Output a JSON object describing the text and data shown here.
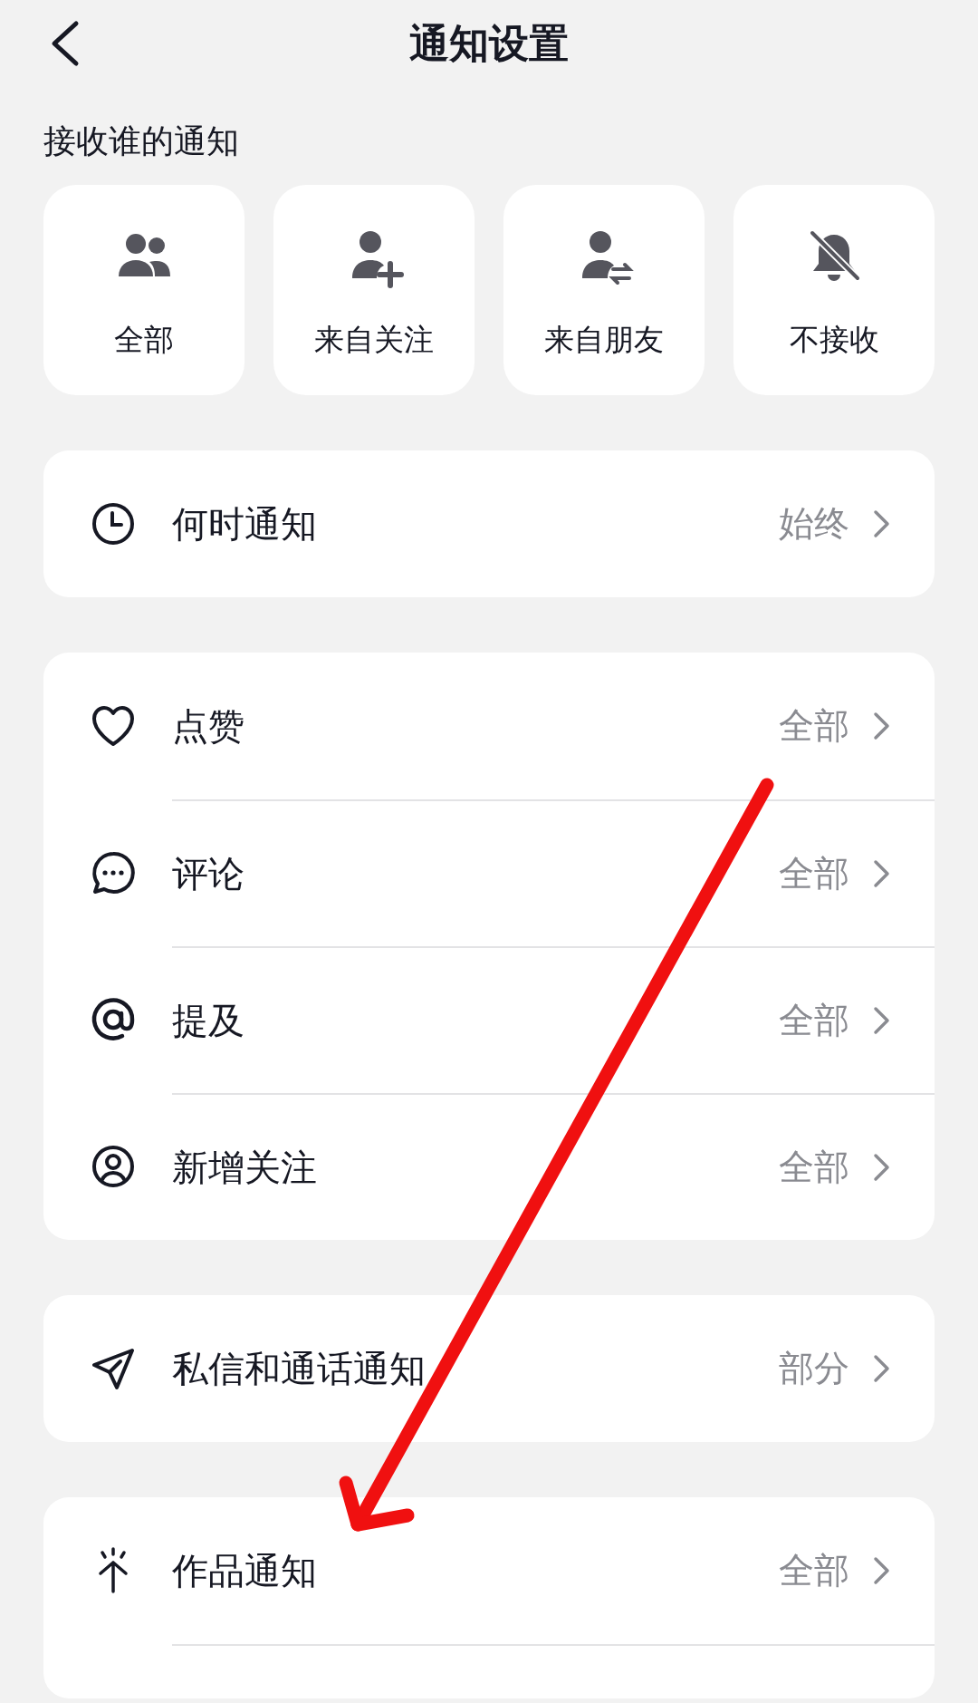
{
  "header": {
    "title": "通知设置"
  },
  "sources": {
    "heading": "接收谁的通知",
    "options": [
      {
        "kind": "all",
        "label": "全部"
      },
      {
        "kind": "following",
        "label": "来自关注"
      },
      {
        "kind": "friends",
        "label": "来自朋友"
      },
      {
        "kind": "none",
        "label": "不接收"
      }
    ]
  },
  "groups": [
    {
      "rows": [
        {
          "kind": "clock",
          "label": "何时通知",
          "value": "始终"
        }
      ]
    },
    {
      "rows": [
        {
          "kind": "heart",
          "label": "点赞",
          "value": "全部"
        },
        {
          "kind": "comment",
          "label": "评论",
          "value": "全部"
        },
        {
          "kind": "at",
          "label": "提及",
          "value": "全部"
        },
        {
          "kind": "person",
          "label": "新增关注",
          "value": "全部"
        }
      ]
    },
    {
      "rows": [
        {
          "kind": "send",
          "label": "私信和通话通知",
          "value": "部分"
        }
      ]
    },
    {
      "rows": [
        {
          "kind": "spark",
          "label": "作品通知",
          "value": "全部"
        }
      ],
      "cut_off": true
    }
  ]
}
